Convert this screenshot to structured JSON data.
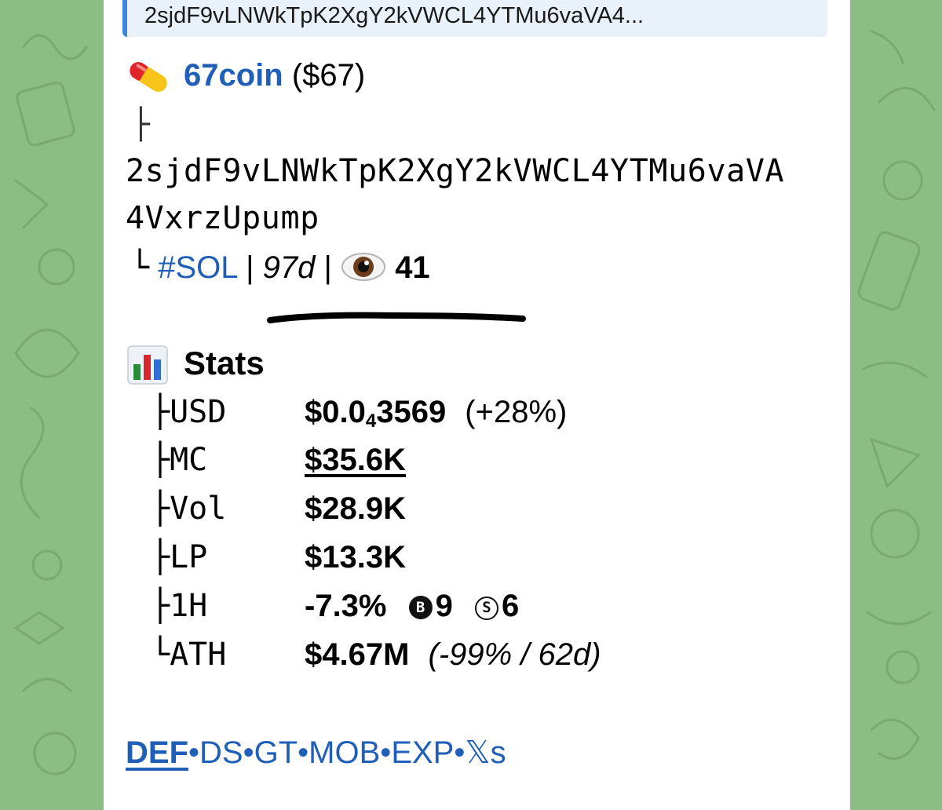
{
  "reply_preview": {
    "text": "2sjdF9vLNWkTpK2XgY2kVWCL4YTMu6vaVA4..."
  },
  "token": {
    "icon": "pill-icon",
    "name": "67coin",
    "ticker": "($67)",
    "branch_top": "├",
    "address_line1": "2sjdF9vLNWkTpK2XgY2kVWCL4YTMu6vaVA",
    "address_line2": "4VxrzUpump",
    "branch_end": "└",
    "chain": "#SOL",
    "sep1": "|",
    "age": "97d",
    "sep2": "|",
    "eye_icon": "eyes-icon",
    "views": "41"
  },
  "stats": {
    "icon": "bar-chart-icon",
    "title": "Stats",
    "rows": [
      {
        "branch": "├",
        "key": "USD",
        "value_main": "$0.0",
        "value_sub": "4",
        "value_rest": "3569",
        "extra": "(+28%)"
      },
      {
        "branch": "├",
        "key": "MC",
        "value": "$35.6K"
      },
      {
        "branch": "├",
        "key": "Vol",
        "value": "$28.9K"
      },
      {
        "branch": "├",
        "key": "LP",
        "value": "$13.3K"
      },
      {
        "branch": "├",
        "key": "1H",
        "value": "-7.3%",
        "buy_badge": "B",
        "buys": "9",
        "sell_badge": "S",
        "sells": "6"
      },
      {
        "branch": "└",
        "key": "ATH",
        "value": "$4.67M",
        "extra": "(-99% / 62d)"
      }
    ]
  },
  "links": {
    "items": [
      "DEF",
      "DS",
      "GT",
      "MOB",
      "EXP",
      "𝕏s"
    ],
    "separator": "•"
  },
  "colors": {
    "link": "#1f5fb8",
    "wallpaper": "#8cbd84",
    "bubble": "#ffffff",
    "quote_bar": "#3d86d6"
  }
}
